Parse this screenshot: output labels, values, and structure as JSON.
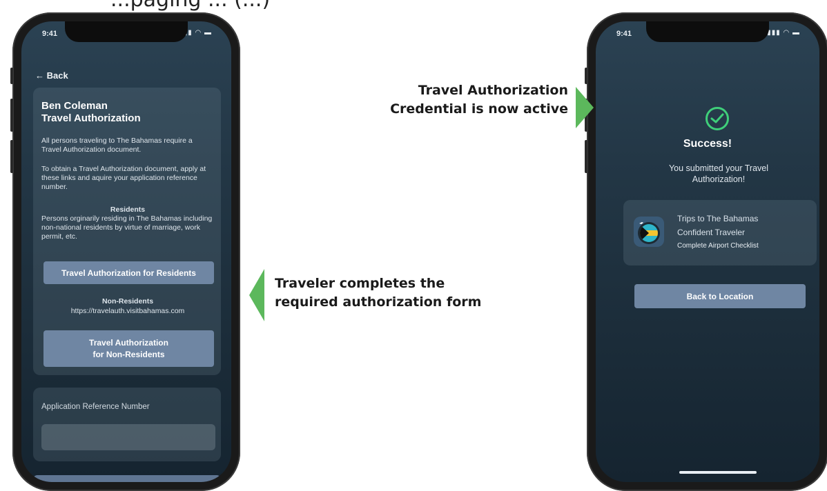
{
  "top_text": "...paging ... (...)",
  "left_phone": {
    "status_time": "9:41",
    "status_icons": "▮▮▮ ◠ ▬",
    "back_label": "← Back",
    "card": {
      "name": "Ben Coleman",
      "title": "Travel Authorization",
      "para1": "All persons traveling to The Bahamas require a Travel Authorization document.",
      "para2": "To obtain a Travel Authorization document, apply at these links and aquire your application reference number.",
      "residents_heading": "Residents",
      "residents_text": "Persons orginarily residing in The Bahamas including non-national residents by virtue of marriage, work permit, etc.",
      "residents_button": "Travel Authorization for Residents",
      "nonresidents_heading": "Non-Residents",
      "nonresidents_url": "https://travelauth.visitbahamas.com",
      "nonresidents_button_line1": "Travel Authorization",
      "nonresidents_button_line2": "for Non-Residents"
    },
    "reference": {
      "label": "Application Reference Number",
      "value": ""
    }
  },
  "right_phone": {
    "status_time": "9:41",
    "status_icons": "▮▮▮ ◠ ▬",
    "success": "Success!",
    "submitted": "You submitted your Travel Authorization!",
    "trip": {
      "line1": "Trips to The Bahamas",
      "line2": "Confident Traveler",
      "line3": "Complete Airport Checklist"
    },
    "back_button": "Back to Location"
  },
  "callouts": {
    "right_top_line1": "Travel Authorization",
    "right_top_line2": "Credential is now active",
    "left_bottom_line1": "Traveler completes the",
    "left_bottom_line2": "required authorization form"
  },
  "colors": {
    "arrow": "#5cb85c",
    "check": "#3fcf7a",
    "button": "#6f86a3"
  }
}
